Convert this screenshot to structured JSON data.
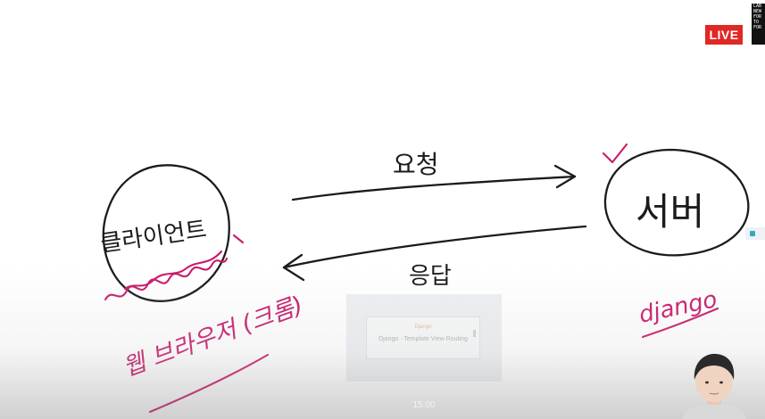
{
  "stream": {
    "live_label": "LIVE",
    "logo_lines": [
      "LAB",
      "NEW",
      "FOR",
      "TO",
      "FOR"
    ]
  },
  "diagram": {
    "client_label": "클라이언트",
    "server_label": "서버",
    "request_label": "요청",
    "response_label": "응답",
    "browser_note": "웹 브라우저 (크롬)",
    "framework_note": "django"
  },
  "background_card": {
    "title": "Django",
    "subtitle": "Django · Template View Routing"
  },
  "caption": {
    "time": "15:00"
  },
  "colors": {
    "ink": "#1b1b1b",
    "annotation": "#c81b6b",
    "live_red": "#e02824",
    "side_tab_accent": "#35a7c6"
  }
}
